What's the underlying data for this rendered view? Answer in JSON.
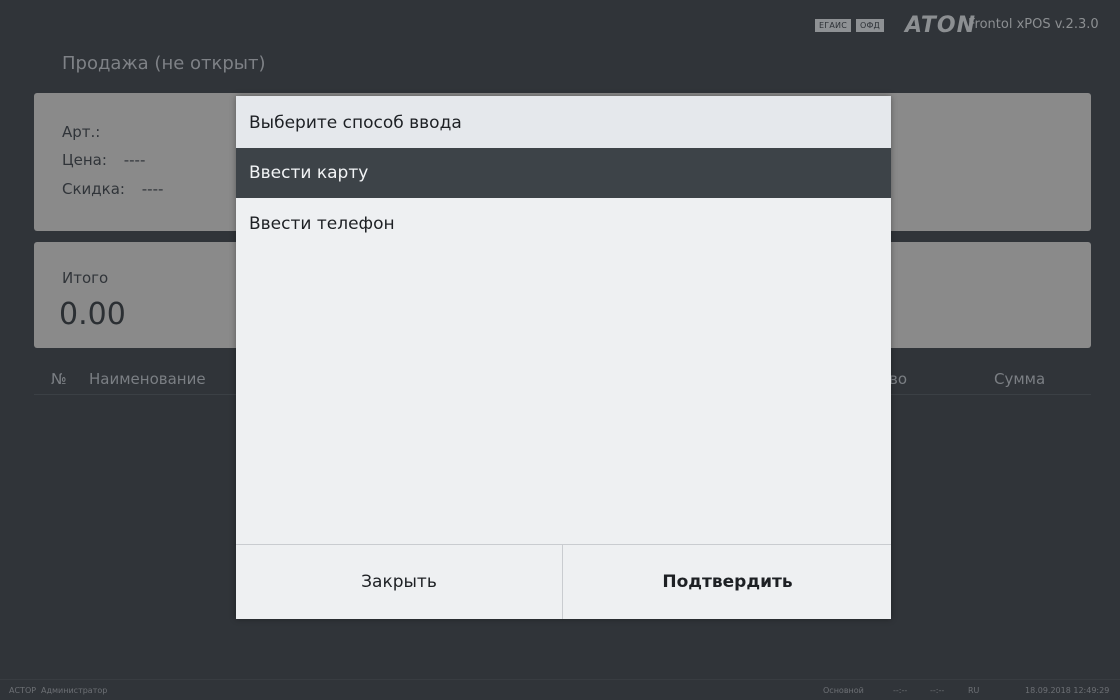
{
  "header": {
    "badges": [
      "ЕГАИС",
      "ОФД"
    ],
    "brand_logo": "ATON",
    "app_version": "Frontol xPOS v.2.3.0",
    "document_title": "Продажа (не открыт)"
  },
  "item_info": {
    "article_label": "Арт.:",
    "article_value": "",
    "price_label": "Цена:",
    "price_value": "----",
    "discount_label": "Скидка:",
    "discount_value": "----"
  },
  "total": {
    "label": "Итого",
    "value": "0.00"
  },
  "table": {
    "columns": [
      "№",
      "Наименование",
      "во",
      "Сумма"
    ]
  },
  "dialog": {
    "title": "Выберите способ ввода",
    "options": [
      {
        "label": "Ввести карту",
        "selected": true
      },
      {
        "label": "Ввести телефон",
        "selected": false
      }
    ],
    "close_label": "Закрыть",
    "confirm_label": "Подтвердить"
  },
  "status_bar": {
    "organization": "АСТОР",
    "user": "Администратор",
    "mode": "Основной",
    "time1": "--:--",
    "time2": "--:--",
    "language": "RU",
    "datetime": "18.09.2018 12:49:29"
  },
  "colors": {
    "background": "#303439",
    "card": "#8a8a8a",
    "dialog": "#eef0f2",
    "selected_option": "#3d4348"
  }
}
